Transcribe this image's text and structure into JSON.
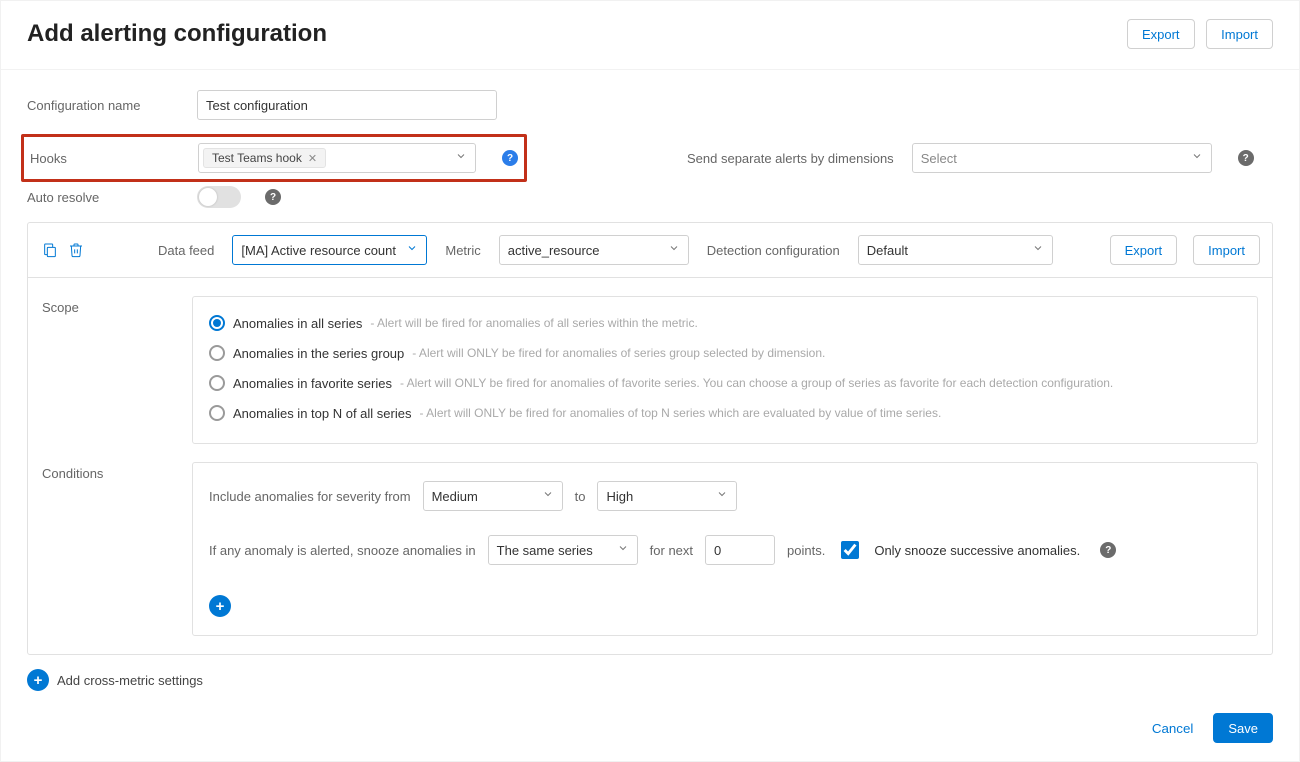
{
  "header": {
    "title": "Add alerting configuration",
    "export": "Export",
    "import": "Import"
  },
  "form": {
    "config_name": {
      "label": "Configuration name",
      "value": "Test configuration"
    },
    "hooks": {
      "label": "Hooks",
      "chip": "Test Teams hook"
    },
    "separate_alerts": {
      "label": "Send separate alerts by dimensions",
      "placeholder": "Select"
    },
    "auto_resolve": {
      "label": "Auto resolve"
    }
  },
  "panel": {
    "data_feed": {
      "label": "Data feed",
      "value": "[MA] Active resource count"
    },
    "metric": {
      "label": "Metric",
      "value": "active_resource"
    },
    "detection": {
      "label": "Detection configuration",
      "value": "Default"
    },
    "export": "Export",
    "import": "Import",
    "scope": {
      "label": "Scope",
      "options": [
        {
          "label": "Anomalies in all series",
          "desc": "- Alert will be fired for anomalies of all series within the metric.",
          "checked": true
        },
        {
          "label": "Anomalies in the series group",
          "desc": "- Alert will ONLY be fired for anomalies of series group selected by dimension.",
          "checked": false
        },
        {
          "label": "Anomalies in favorite series",
          "desc": "- Alert will ONLY be fired for anomalies of favorite series. You can choose a group of series as favorite for each detection configuration.",
          "checked": false
        },
        {
          "label": "Anomalies in top N of all series",
          "desc": "- Alert will ONLY be fired for anomalies of top N series which are evaluated by value of time series.",
          "checked": false
        }
      ]
    },
    "conditions": {
      "label": "Conditions",
      "include_text": "Include anomalies for severity from",
      "from": "Medium",
      "to_text": "to",
      "to": "High",
      "snooze_pre": "If any anomaly is alerted, snooze anomalies in",
      "snooze_scope": "The same series",
      "for_next": "for next",
      "points_value": "0",
      "points_label": "points.",
      "only_successive": "Only snooze successive anomalies."
    },
    "cross_metric": "Add cross-metric settings"
  },
  "footer": {
    "cancel": "Cancel",
    "save": "Save"
  }
}
